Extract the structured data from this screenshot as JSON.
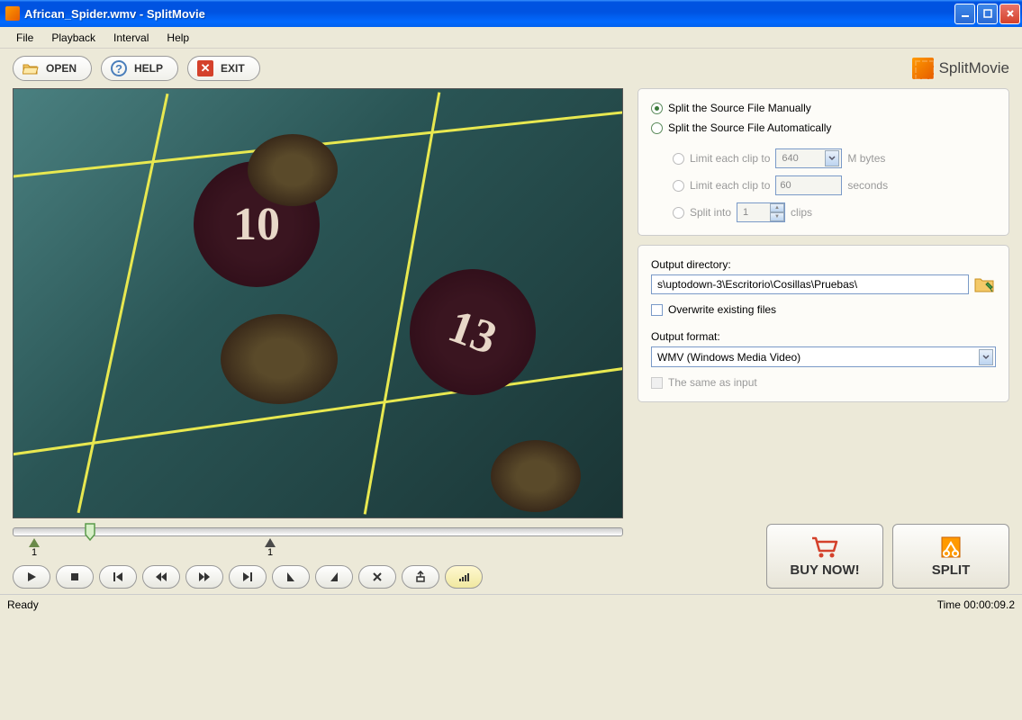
{
  "window": {
    "title": "African_Spider.wmv - SplitMovie"
  },
  "menu": {
    "file": "File",
    "playback": "Playback",
    "interval": "Interval",
    "help": "Help"
  },
  "toolbar": {
    "open": "OPEN",
    "help": "HELP",
    "exit": "EXIT",
    "brand": "SplitMovie"
  },
  "video": {
    "num1": "10",
    "num2": "13"
  },
  "timeline": {
    "marker_start": "1",
    "marker_end": "1"
  },
  "split_options": {
    "manual": "Split the Source File Manually",
    "auto": "Split the Source File Automatically",
    "limit_bytes_pre": "Limit each clip to",
    "limit_bytes_val": "640",
    "limit_bytes_unit": "M bytes",
    "limit_secs_pre": "Limit each clip to",
    "limit_secs_val": "60",
    "limit_secs_unit": "seconds",
    "split_into_pre": "Split into",
    "split_into_val": "1",
    "split_into_unit": "clips"
  },
  "output": {
    "dir_label": "Output directory:",
    "dir_value": "s\\uptodown-3\\Escritorio\\Cosillas\\Pruebas\\",
    "overwrite": "Overwrite existing files",
    "format_label": "Output format:",
    "format_value": "WMV (Windows Media Video)",
    "same_as_input": "The same as input"
  },
  "actions": {
    "buy": "BUY NOW!",
    "split": "SPLIT"
  },
  "status": {
    "left": "Ready",
    "right": "Time 00:00:09.2"
  }
}
